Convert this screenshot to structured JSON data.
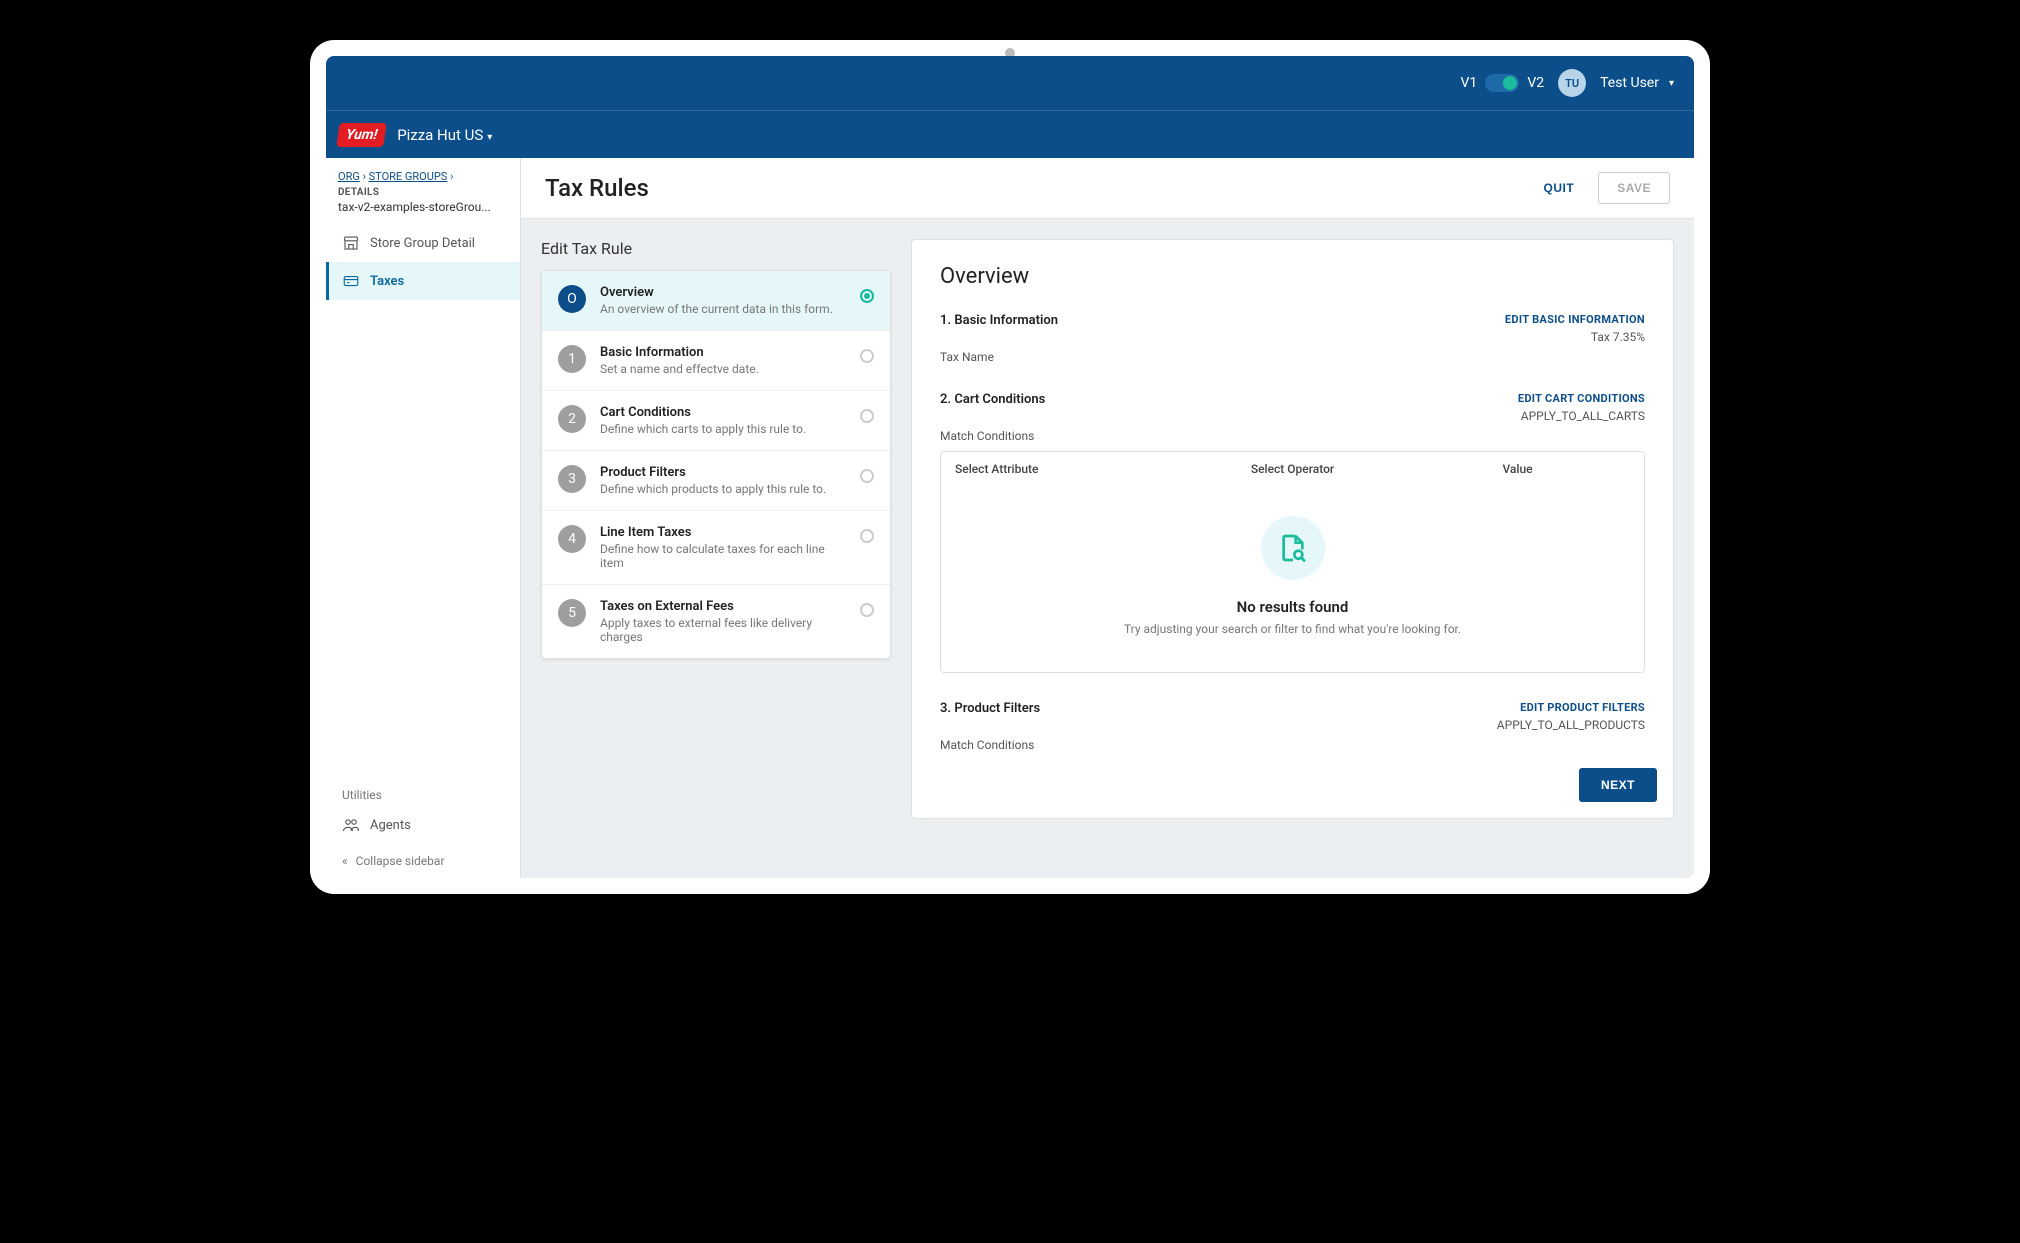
{
  "topbar": {
    "v1_label": "V1",
    "v2_label": "V2",
    "avatar_initials": "TU",
    "username": "Test User"
  },
  "brandbar": {
    "logo_text": "Yum!",
    "brand_name": "Pizza Hut US"
  },
  "sidebar": {
    "breadcrumb": {
      "org": "ORG",
      "sep": "›",
      "store_groups": "STORE GROUPS"
    },
    "details_label": "DETAILS",
    "details_path": "tax-v2-examples-storeGrou...",
    "items": [
      {
        "label": "Store Group Detail"
      },
      {
        "label": "Taxes"
      }
    ],
    "utilities_label": "Utilities",
    "agents_label": "Agents",
    "collapse_label": "Collapse sidebar"
  },
  "header": {
    "title": "Tax Rules",
    "quit": "QUIT",
    "save": "SAVE"
  },
  "subhead": "Edit Tax Rule",
  "steps": [
    {
      "num": "O",
      "title": "Overview",
      "desc": "An overview of the current data in this form."
    },
    {
      "num": "1",
      "title": "Basic Information",
      "desc": "Set a name and effectve date."
    },
    {
      "num": "2",
      "title": "Cart Conditions",
      "desc": "Define which carts to apply this rule to."
    },
    {
      "num": "3",
      "title": "Product Filters",
      "desc": "Define which products to apply this rule to."
    },
    {
      "num": "4",
      "title": "Line Item Taxes",
      "desc": "Define how to calculate taxes for each line item"
    },
    {
      "num": "5",
      "title": "Taxes on External Fees",
      "desc": "Apply taxes to external fees like delivery charges"
    }
  ],
  "detail": {
    "title": "Overview",
    "basic": {
      "section": "1. Basic Information",
      "edit": "EDIT BASIC INFORMATION",
      "field": "Tax Name",
      "value": "Tax 7.35%"
    },
    "cart": {
      "section": "2. Cart Conditions",
      "edit": "EDIT CART CONDITIONS",
      "value": "APPLY_TO_ALL_CARTS",
      "match": "Match Conditions",
      "cols": {
        "attr": "Select Attribute",
        "op": "Select Operator",
        "val": "Value"
      },
      "empty_title": "No results found",
      "empty_desc": "Try adjusting your search or filter to find what you're looking for."
    },
    "product": {
      "section": "3. Product Filters",
      "edit": "EDIT PRODUCT FILTERS",
      "value": "APPLY_TO_ALL_PRODUCTS",
      "match": "Match Conditions"
    },
    "next": "NEXT"
  }
}
